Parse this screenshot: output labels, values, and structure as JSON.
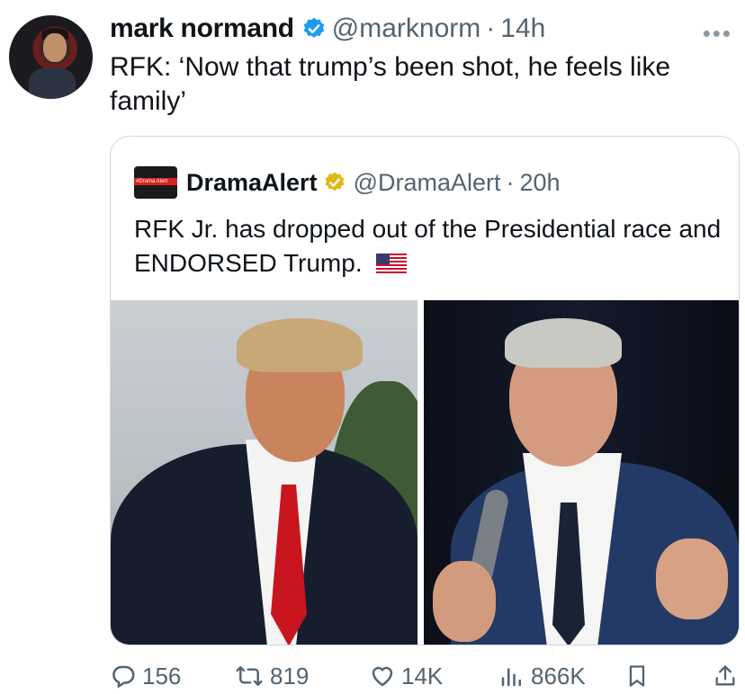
{
  "tweet": {
    "author_name": "mark normand",
    "handle": "@marknorm",
    "separator": "·",
    "time": "14h",
    "text": "RFK: ‘Now that trump’s been shot, he feels like family’",
    "more": "•••"
  },
  "quote": {
    "author_name": "DramaAlert",
    "avatar_text": "#Drama Alert",
    "handle": "@DramaAlert",
    "separator": "·",
    "time": "20h",
    "text": "RFK Jr. has dropped out of the Presidential race and ENDORSED Trump.",
    "flag_icon": "us-flag-icon"
  },
  "actions": {
    "replies": "156",
    "reposts": "819",
    "likes": "14K",
    "views": "866K"
  },
  "colors": {
    "verified_blue": "#1d9bf0",
    "verified_gold": "#e2b719",
    "secondary_text": "#536471",
    "border": "#cfd9de"
  }
}
